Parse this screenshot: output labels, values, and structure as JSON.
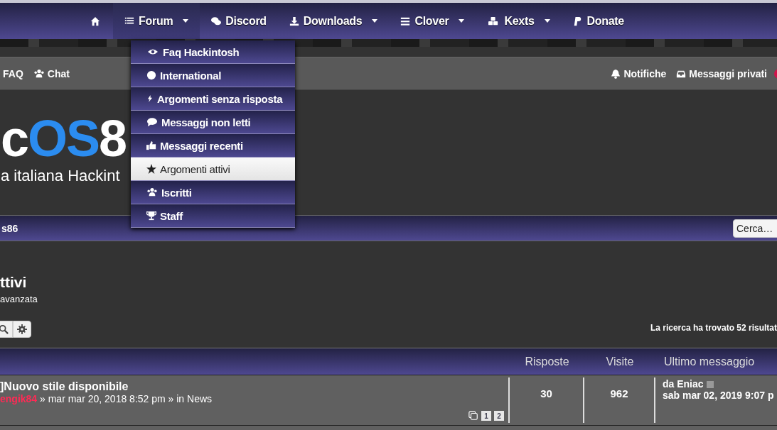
{
  "nav": {
    "items": [
      {
        "selected": false,
        "caret": false
      },
      {
        "label": "Forum",
        "selected": true,
        "caret": true
      },
      {
        "label": "Discord",
        "selected": false,
        "caret": false
      },
      {
        "label": "Downloads",
        "selected": false,
        "caret": true
      },
      {
        "label": "Clover",
        "selected": false,
        "caret": true
      },
      {
        "label": "Kexts",
        "selected": false,
        "caret": true
      },
      {
        "label": "Donate",
        "selected": false,
        "caret": false
      }
    ]
  },
  "dropdown": {
    "items": [
      {
        "label": "Faq Hackintosh",
        "selected": false
      },
      {
        "label": "International",
        "selected": false
      },
      {
        "label": "Argomenti senza risposta",
        "selected": false
      },
      {
        "label": "Messaggi non letti",
        "selected": false
      },
      {
        "label": "Messaggi recenti",
        "selected": false
      },
      {
        "label": "Argomenti attivi",
        "selected": true
      },
      {
        "label": "Iscritti",
        "selected": false
      },
      {
        "label": "Staff",
        "selected": false
      }
    ]
  },
  "subnav": {
    "left": [
      "FAQ",
      "Chat"
    ],
    "right": [
      "Notifiche",
      "Messaggi privati"
    ]
  },
  "logo": {
    "part1": "c",
    "part2": "OS",
    "part3": "8",
    "tagline": "a italiana Hackint"
  },
  "breadcrumb": {
    "text": "s86",
    "search_placeholder": "Cerca…"
  },
  "page": {
    "title": "ttivi",
    "subtitle": "avanzata",
    "results": "La ricerca ha trovato 52 risultat"
  },
  "table": {
    "columns": [
      "Risposte",
      "Visite",
      "Ultimo messaggio"
    ],
    "rows": [
      {
        "title": "]Nuovo stile disponibile",
        "author": "engik84",
        "meta": "» mar mar 20, 2018 8:52 pm » in",
        "forum": "News",
        "pages": [
          "1",
          "2"
        ],
        "replies": "30",
        "views": "962",
        "last_by": "da Eniac",
        "last_time": "sab mar 02, 2019 9:07 p"
      }
    ]
  }
}
